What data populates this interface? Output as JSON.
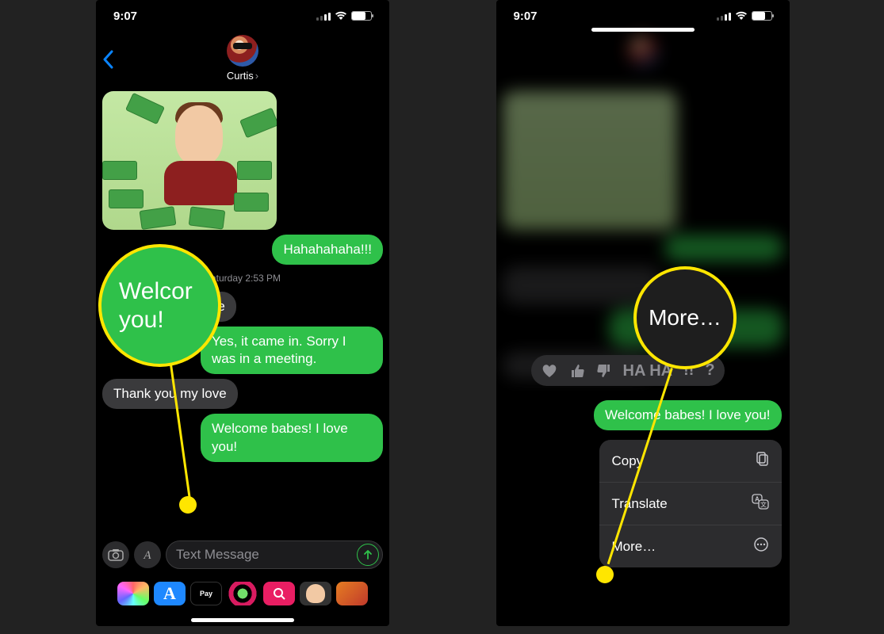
{
  "status": {
    "time": "9:07"
  },
  "header": {
    "contact_name": "Curtis"
  },
  "messages": {
    "m1": "Hahahahaha!!!",
    "timestamp": "Saturday 2:53 PM",
    "m2_partial": "e another package",
    "m3": "Yes, it came in. Sorry I was in a meeting.",
    "m4": "Thank you my love",
    "m5": "Welcome babes! I love you!"
  },
  "input": {
    "placeholder": "Text Message"
  },
  "apps": {
    "pay": " Pay",
    "appstore": "A"
  },
  "callouts": {
    "left_label_l1": "Welcor",
    "left_label_l2": "you!",
    "right_label": "More…"
  },
  "tapback": {
    "haha": "HA HA",
    "exclaim": "!!",
    "question": "?"
  },
  "context_menu": {
    "copy": "Copy",
    "translate": "Translate",
    "more": "More…"
  }
}
